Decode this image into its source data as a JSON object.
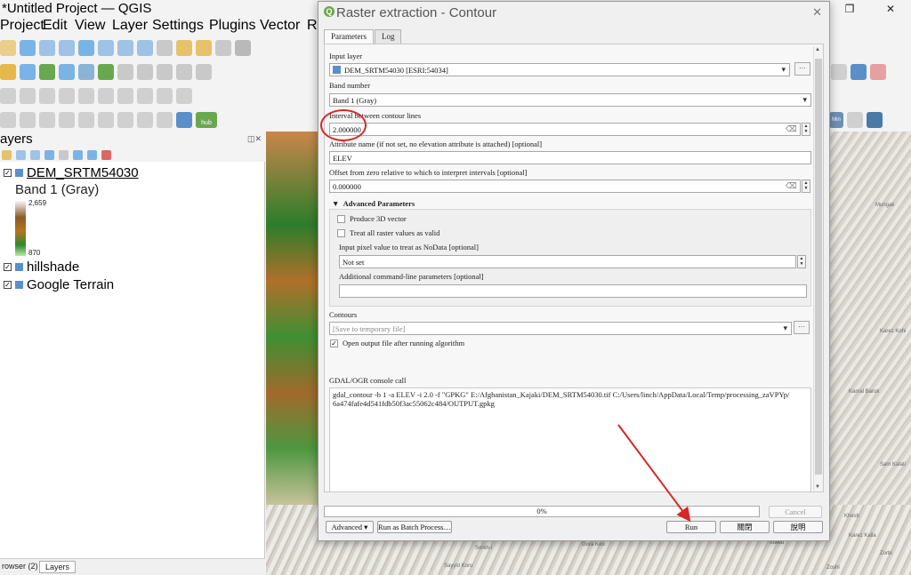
{
  "window": {
    "title": "*Untitled Project — QGIS",
    "controls": [
      "—",
      "❐",
      "✕"
    ]
  },
  "menu": [
    "Project",
    "Edit",
    "View",
    "Layer",
    "Settings",
    "Plugins",
    "Vector",
    "Ra"
  ],
  "toolbar": {
    "hub_label": "hub",
    "right_label": "Min"
  },
  "layers_panel": {
    "title": "ayers",
    "layers": [
      {
        "name": "DEM_SRTM54030",
        "checked": true
      },
      {
        "name": "hillshade",
        "checked": true
      },
      {
        "name": "Google Terrain",
        "checked": true
      }
    ],
    "band_label": "Band 1 (Gray)",
    "ramp_max": "2,659",
    "ramp_min": "870"
  },
  "bottom_tabs": [
    "rowser (2)",
    "Layers"
  ],
  "map_labels": [
    "Mungak",
    "Karez Kohi",
    "Kamal Baruk",
    "Sam Kalati",
    "Khesh",
    "Karez Kalla",
    "Zorbi",
    "Zoshi",
    "Toweb",
    "Gora Koo",
    "Sorkh-i",
    "Sayyid Koru"
  ],
  "dialog": {
    "title": "Raster extraction - Contour",
    "close_label": "✕",
    "tabs": [
      "Parameters",
      "Log"
    ],
    "input_layer_label": "Input layer",
    "input_layer_value": "DEM_SRTM54030 [ESRI:54034]",
    "band_number_label": "Band number",
    "band_number_value": "Band 1 (Gray)",
    "interval_label": "Interval between contour lines",
    "interval_value": "2.000000",
    "attribute_label": "Attribute name (if not set, no elevation attribute is attached) [optional]",
    "attribute_value": "ELEV",
    "offset_label": "Offset from zero relative to which to interpret intervals [optional]",
    "offset_value": "0.000000",
    "advanced_title": "Advanced Parameters",
    "produce_3d_label": "Produce 3D vector",
    "treat_nodata_label": "Treat all raster values as valid",
    "nodata_label": "Input pixel value to treat as NoData [optional]",
    "nodata_value": "Not set",
    "extra_label": "Additional command-line parameters [optional]",
    "extra_value": "",
    "contours_label": "Contours",
    "contours_placeholder": "[Save to temporary file]",
    "open_output_label": "Open output file after running algorithm",
    "console_label": "GDAL/OGR console call",
    "console_line1": "gdal_contour -b 1 -a ELEV -i 2.0 -f \"GPKG\" E:/Afghanistan_Kajaki/DEM_SRTM54030.tif C:/Users/linch/AppData/Local/Temp/processing_zaVPYp/",
    "console_line2": "6a474fafe4d541fdb50f3ac55062c484/OUTPUT.gpkg",
    "progress_label": "0%",
    "cancel_label": "Cancel",
    "advanced_button": "Advanced",
    "batch_button": "Run as Batch Process…",
    "run_button": "Run",
    "close_button": "關閉",
    "help_button": "說明"
  },
  "colors": {
    "annotation": "#d62828",
    "qgis_green": "#6aa84f"
  }
}
